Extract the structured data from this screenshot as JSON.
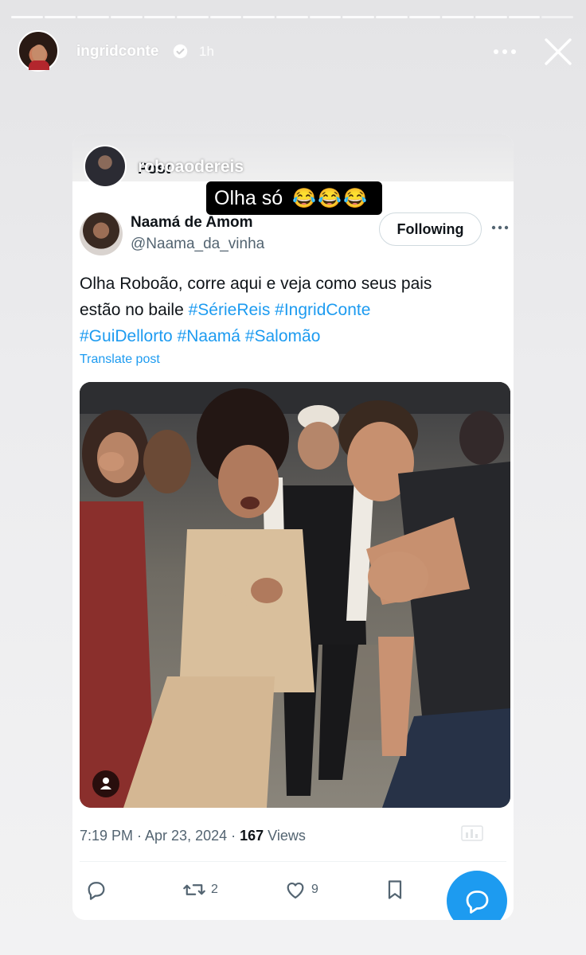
{
  "story": {
    "username": "ingridconte",
    "time": "1h",
    "segments": 17,
    "current_segment": 17
  },
  "card": {
    "topbar_title": "Post",
    "mention_username": "roboaodereis",
    "sticker_text": "Olha só",
    "sticker_emoji": "😂😂😂",
    "author": {
      "name": "Naamá de Amom",
      "handle": "@Naama_da_vinha"
    },
    "follow_label": "Following",
    "text": {
      "line1": "Olha Roboão, corre aqui e veja como seus pais",
      "line2_plain": "estão no baile ",
      "tags": [
        "#SérieReis",
        "#IngridConte",
        "#GuiDellorto",
        "#Naamá",
        "#Salomão"
      ]
    },
    "translate_label": "Translate post",
    "meta": {
      "time_date": "7:19 PM · Apr 23, 2024 · ",
      "views_count": "167",
      "views_label": " Views"
    },
    "actions": {
      "retweets": "2",
      "likes": "9"
    }
  },
  "colors": {
    "accent": "#1d9bf0",
    "text": "#0f1419",
    "secondary": "#536471"
  },
  "icons": [
    "verified-icon",
    "more-icon",
    "close-icon",
    "reply-icon",
    "retweet-icon",
    "like-icon",
    "bookmark-icon",
    "analytics-icon",
    "person-tag-icon",
    "compose-icon"
  ]
}
